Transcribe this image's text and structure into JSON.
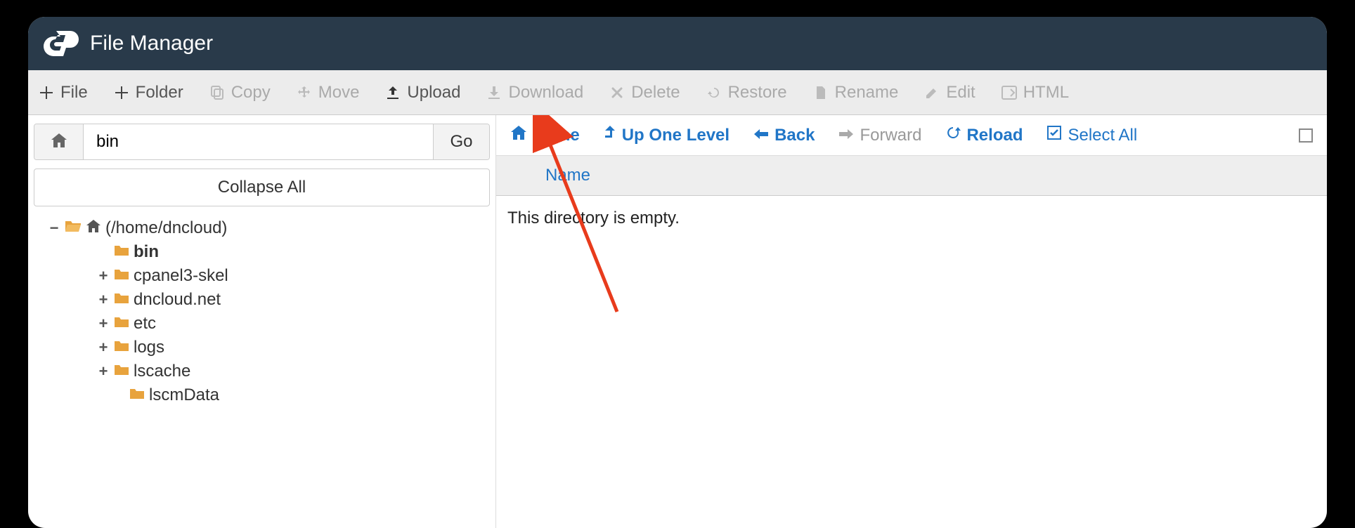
{
  "header": {
    "title": "File Manager"
  },
  "toolbar": {
    "file": "File",
    "folder": "Folder",
    "copy": "Copy",
    "move": "Move",
    "upload": "Upload",
    "download": "Download",
    "delete": "Delete",
    "restore": "Restore",
    "rename": "Rename",
    "edit": "Edit",
    "html": "HTML"
  },
  "sidebar": {
    "path_value": "bin",
    "go_label": "Go",
    "collapse_label": "Collapse All",
    "tree": {
      "root": "(/home/dncloud)",
      "items": [
        {
          "label": "bin",
          "bold": true,
          "toggle": ""
        },
        {
          "label": "cpanel3-skel",
          "toggle": "+"
        },
        {
          "label": "dncloud.net",
          "toggle": "+"
        },
        {
          "label": "etc",
          "toggle": "+"
        },
        {
          "label": "logs",
          "toggle": "+"
        },
        {
          "label": "lscache",
          "toggle": "+"
        },
        {
          "label": "lscmData",
          "toggle": "",
          "indent": true
        }
      ]
    }
  },
  "nav": {
    "home": "Home",
    "up": "Up One Level",
    "back": "Back",
    "forward": "Forward",
    "reload": "Reload",
    "select_all": "Select All"
  },
  "table": {
    "col_name": "Name",
    "empty_msg": "This directory is empty."
  }
}
